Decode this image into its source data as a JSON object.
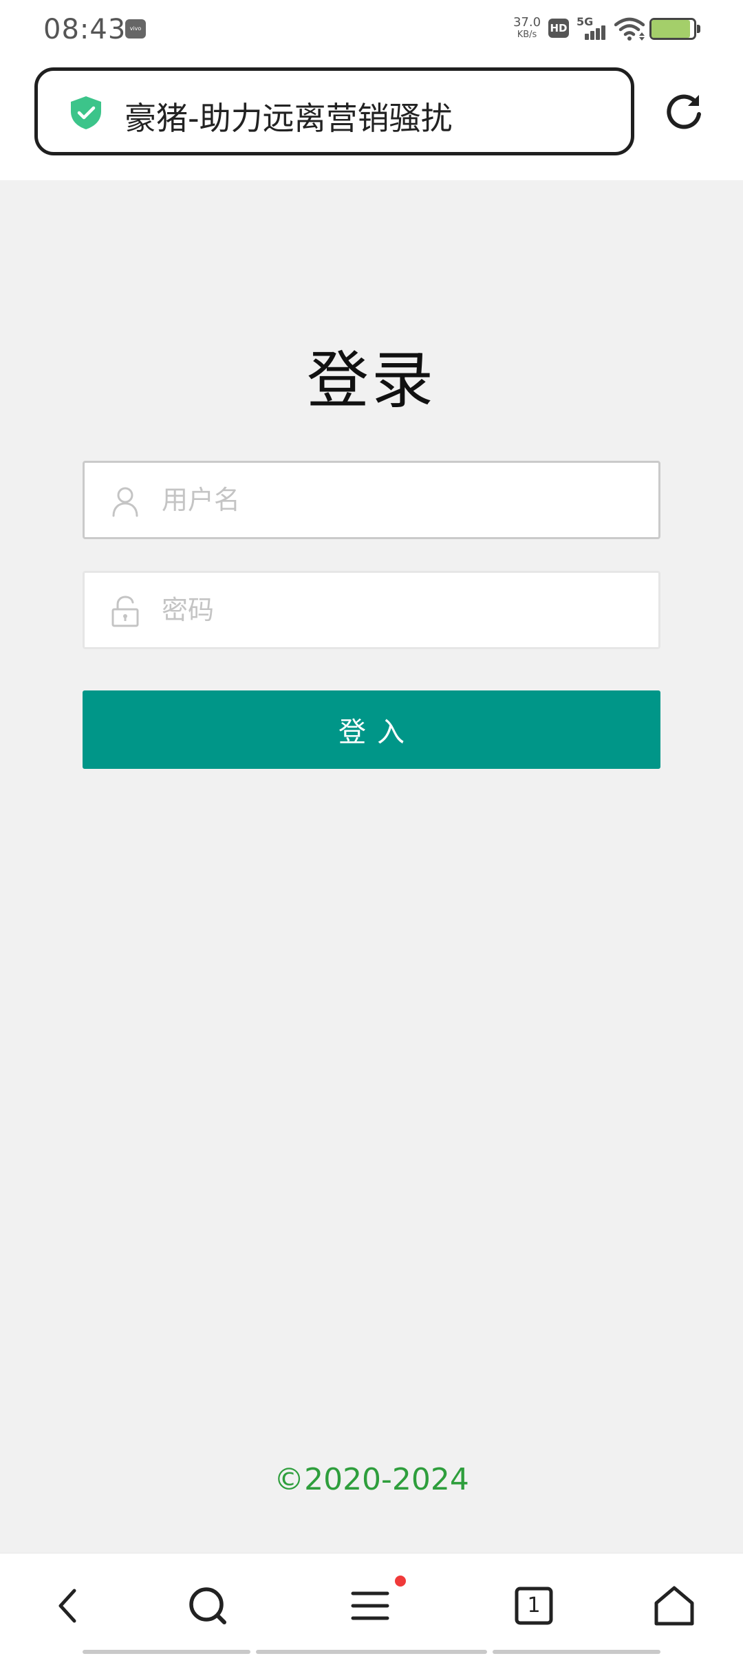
{
  "status_bar": {
    "time": "08:43",
    "vendor_badge": "vivo",
    "net_speed_value": "37.0",
    "net_speed_unit": "KB/s",
    "hd_label": "HD",
    "network_label": "5G",
    "battery_level": 0.9,
    "battery_color": "#a4cf6a"
  },
  "address_bar": {
    "title": "豪猪-助力远离营销骚扰",
    "secure_icon": "shield-check-icon",
    "secure_color": "#3cc48a",
    "refresh_icon": "refresh-icon"
  },
  "login": {
    "title": "登录",
    "username": {
      "icon": "user-icon",
      "value": "",
      "placeholder": "用户名"
    },
    "password": {
      "icon": "lock-icon",
      "value": "",
      "placeholder": "密码"
    },
    "submit_label": "登入",
    "submit_color": "#009688"
  },
  "footer": {
    "copyright": "©2020-2024",
    "copyright_color": "#2e9e3c"
  },
  "bottom_nav": {
    "items": [
      {
        "name": "back",
        "icon": "chevron-left-icon"
      },
      {
        "name": "search",
        "icon": "search-icon"
      },
      {
        "name": "menu",
        "icon": "hamburger-menu-icon",
        "has_notification": true
      },
      {
        "name": "tabs",
        "icon": "tabs-icon",
        "count": "1"
      },
      {
        "name": "home",
        "icon": "home-icon"
      }
    ]
  }
}
